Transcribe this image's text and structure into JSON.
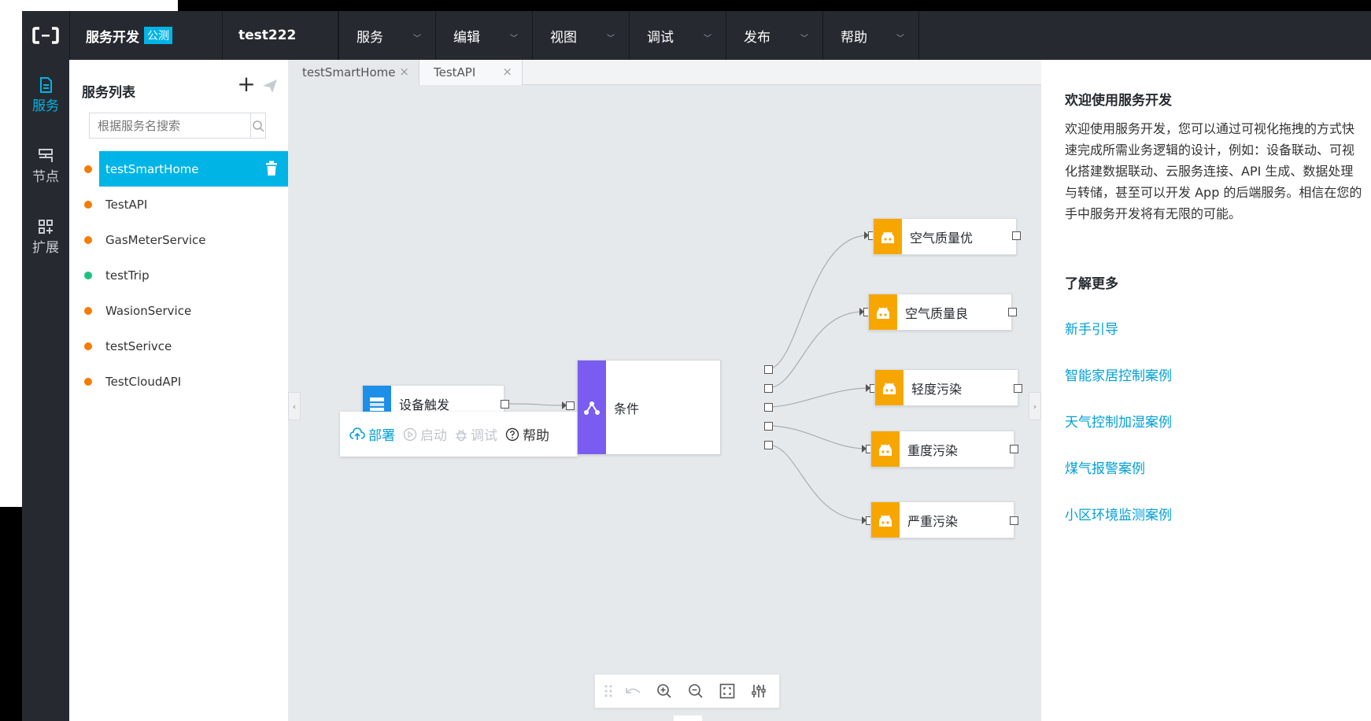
{
  "topbar": {
    "product": "服务开发",
    "badge": "公测",
    "project": "test222",
    "menus": [
      "服务",
      "编辑",
      "视图",
      "调试",
      "发布",
      "帮助"
    ]
  },
  "rail": [
    {
      "label": "服务",
      "icon": "document-icon",
      "active": true
    },
    {
      "label": "节点",
      "icon": "node-icon",
      "active": false
    },
    {
      "label": "扩展",
      "icon": "extension-icon",
      "active": false
    }
  ],
  "service_list": {
    "title": "服务列表",
    "search_placeholder": "根据服务名搜索",
    "items": [
      {
        "name": "testSmartHome",
        "status_color": "#f57c00",
        "active": true
      },
      {
        "name": "TestAPI",
        "status_color": "#f57c00"
      },
      {
        "name": "GasMeterService",
        "status_color": "#f57c00"
      },
      {
        "name": "testTrip",
        "status_color": "#1bc47d"
      },
      {
        "name": "WasionService",
        "status_color": "#f57c00"
      },
      {
        "name": "testSerivce",
        "status_color": "#f57c00"
      },
      {
        "name": "TestCloudAPI",
        "status_color": "#f57c00"
      }
    ]
  },
  "tabs": [
    {
      "label": "testSmartHome"
    },
    {
      "label": "TestAPI"
    }
  ],
  "flow": {
    "trigger": {
      "label": "设备触发",
      "color": "#1e8fe8"
    },
    "condition": {
      "label": "条件",
      "color": "#7b5cf0"
    },
    "outputs": [
      {
        "label": "空气质量优",
        "color": "#f7a600"
      },
      {
        "label": "空气质量良",
        "color": "#f7a600"
      },
      {
        "label": "轻度污染",
        "color": "#f7a600"
      },
      {
        "label": "重度污染",
        "color": "#f7a600"
      },
      {
        "label": "严重污染",
        "color": "#f7a600"
      }
    ]
  },
  "popover": {
    "deploy": "部署",
    "start": "启动",
    "debug": "调试",
    "help": "帮助"
  },
  "right_panel": {
    "title": "欢迎使用服务开发",
    "intro": "欢迎使用服务开发，您可以通过可视化拖拽的方式快速完成所需业务逻辑的设计，例如：设备联动、可视化搭建数据联动、云服务连接、API 生成、数据处理与转储，甚至可以开发 App 的后端服务。相信在您的手中服务开发将有无限的可能。",
    "more_title": "了解更多",
    "links": [
      "新手引导",
      "智能家居控制案例",
      "天气控制加湿案例",
      "煤气报警案例",
      "小区环境监测案例"
    ]
  },
  "colors": {
    "accent": "#00b4e6",
    "dark": "#262a30",
    "link": "#00a0d8"
  }
}
